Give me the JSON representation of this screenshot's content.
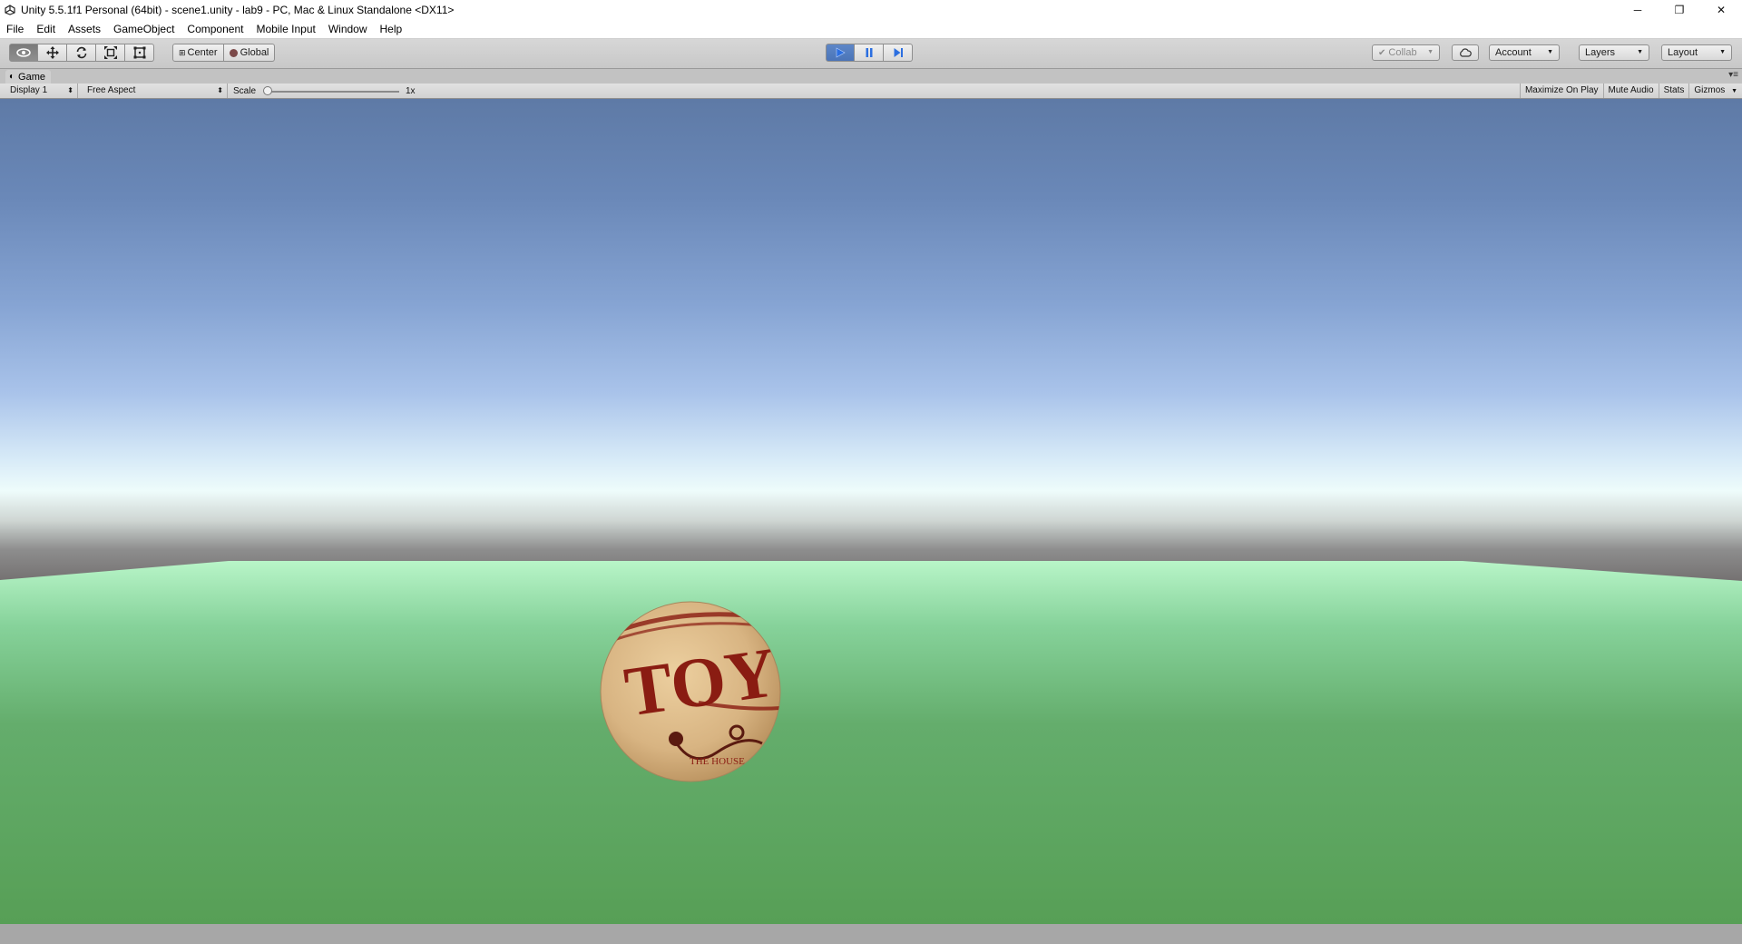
{
  "window": {
    "title": "Unity 5.5.1f1 Personal (64bit) - scene1.unity - lab9 - PC, Mac & Linux Standalone <DX11>",
    "controls": {
      "minimize": "─",
      "restore": "❐",
      "close": "✕"
    }
  },
  "menubar": {
    "items": [
      "File",
      "Edit",
      "Assets",
      "GameObject",
      "Component",
      "Mobile Input",
      "Window",
      "Help"
    ]
  },
  "toolbar": {
    "transform_tools": [
      "hand-tool",
      "move-tool",
      "rotate-tool",
      "scale-tool",
      "rect-tool"
    ],
    "active_tool": "hand-tool",
    "pivot_mode": "Center",
    "pivot_rotation": "Global",
    "play_state": "playing",
    "collab": "Collab",
    "account": "Account",
    "layers": "Layers",
    "layout": "Layout"
  },
  "game_view": {
    "tab_label": "Game",
    "display": "Display 1",
    "aspect": "Free Aspect",
    "scale_label": "Scale",
    "scale_value": "1x",
    "buttons": [
      "Maximize On Play",
      "Mute Audio",
      "Stats",
      "Gizmos"
    ]
  },
  "scene": {
    "ball_text": "TOY",
    "ball_subtext": "THE HOUSE"
  },
  "colors": {
    "play_active": "#4a74b8",
    "sky_top": "#5e7aa6",
    "ground": "#5da563",
    "ball_base": "#d9b88a",
    "ball_text": "#8a1c12"
  }
}
